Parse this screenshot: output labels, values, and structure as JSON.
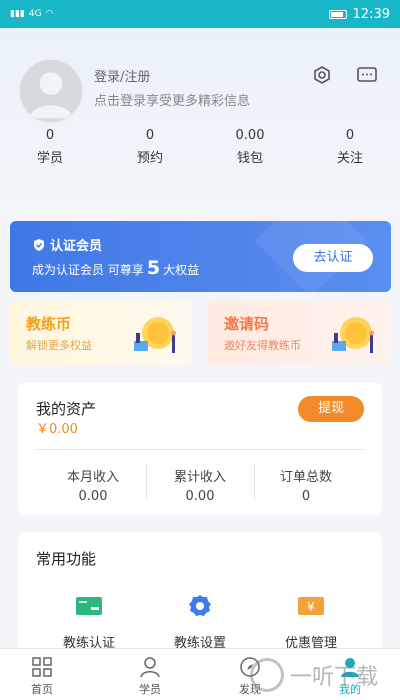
{
  "status_bar": {
    "signal": "4G",
    "time": "12:39"
  },
  "profile": {
    "login_link": "登录/注册",
    "login_hint": "点击登录享受更多精彩信息",
    "stats": [
      {
        "value": "0",
        "label": "学员"
      },
      {
        "value": "0",
        "label": "预约"
      },
      {
        "value": "0.00",
        "label": "钱包"
      },
      {
        "value": "0",
        "label": "关注"
      }
    ]
  },
  "member_banner": {
    "title": "认证会员",
    "desc_prefix": "成为认证会员 可尊享",
    "desc_number": "5",
    "desc_suffix": "大权益",
    "button": "去认证"
  },
  "coin_cards": [
    {
      "title": "教练币",
      "subtitle": "解锁更多权益"
    },
    {
      "title": "邀请码",
      "subtitle": "邀好友得教练币"
    }
  ],
  "assets": {
    "title": "我的资产",
    "amount": "￥0.00",
    "withdraw_button": "提现",
    "stats": [
      {
        "label": "本月收入",
        "value": "0.00"
      },
      {
        "label": "累计收入",
        "value": "0.00"
      },
      {
        "label": "订单总数",
        "value": "0"
      }
    ]
  },
  "functions": {
    "title": "常用功能",
    "items": [
      {
        "label": "教练认证",
        "icon": "id-card-icon",
        "color": "#2fb67c"
      },
      {
        "label": "教练设置",
        "icon": "gear-icon",
        "color": "#3e7ee6"
      },
      {
        "label": "优惠管理",
        "icon": "coupon-icon",
        "color": "#f2a23a"
      }
    ]
  },
  "bottom_nav": {
    "items": [
      {
        "label": "首页",
        "icon": "home-grid-icon"
      },
      {
        "label": "学员",
        "icon": "student-icon"
      },
      {
        "label": "发现",
        "icon": "discover-icon"
      },
      {
        "label": "我的",
        "icon": "profile-icon"
      }
    ],
    "active_index": 3
  },
  "watermark": "一听下载",
  "colors": {
    "status_bar": "#18b7c7",
    "banner": "#3f78e6",
    "accent_orange": "#f38a2a",
    "active_tab": "#1aa9bd"
  }
}
